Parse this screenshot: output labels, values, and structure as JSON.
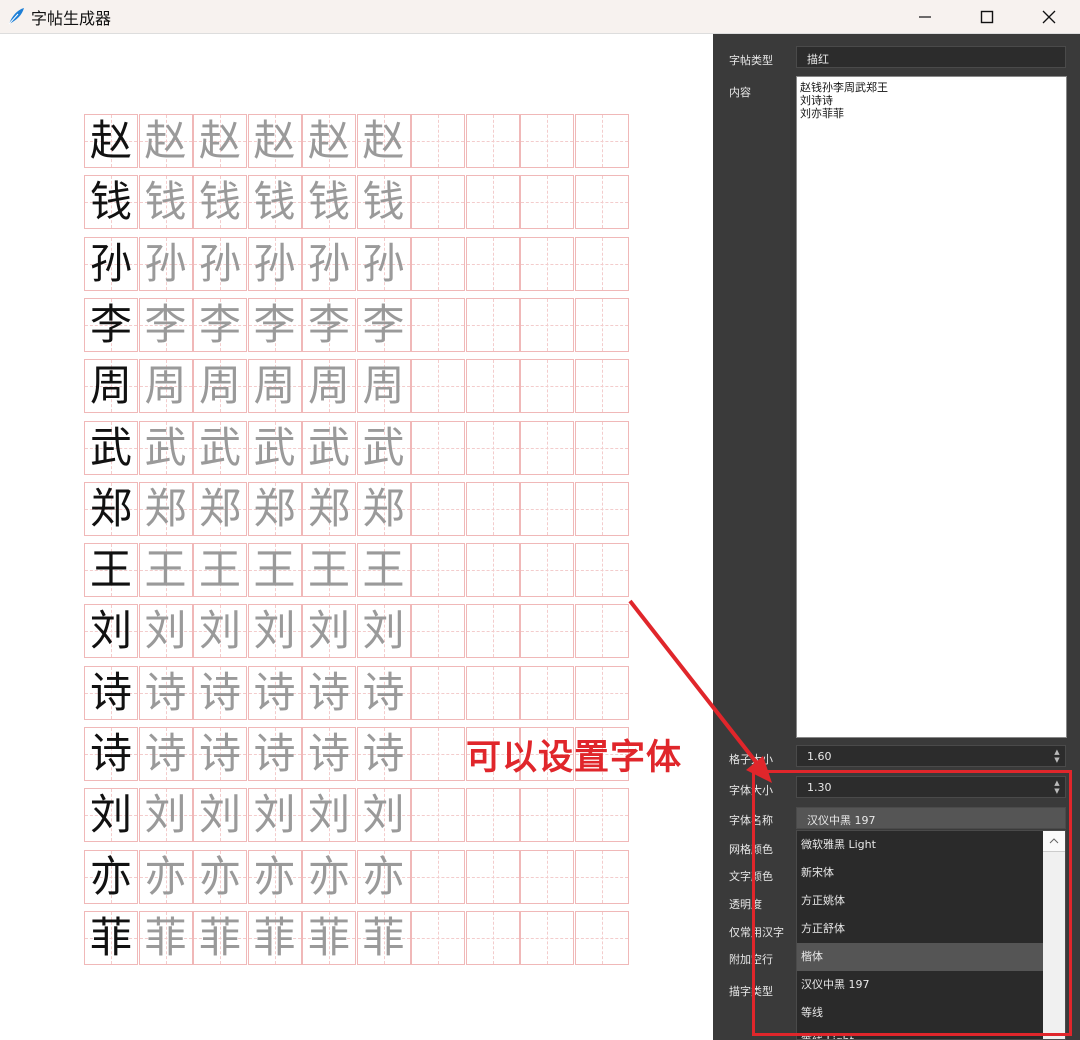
{
  "window": {
    "title": "字帖生成器"
  },
  "sheet": {
    "rows": [
      {
        "char": "赵"
      },
      {
        "char": "钱"
      },
      {
        "char": "孙"
      },
      {
        "char": "李"
      },
      {
        "char": "周"
      },
      {
        "char": "武"
      },
      {
        "char": "郑"
      },
      {
        "char": "王"
      },
      {
        "char": "刘"
      },
      {
        "char": "诗"
      },
      {
        "char": "诗"
      },
      {
        "char": "刘"
      },
      {
        "char": "亦"
      },
      {
        "char": "菲"
      }
    ],
    "copies_per_row": 6,
    "cells_per_row": 10
  },
  "panel": {
    "type_label": "字帖类型",
    "type_value": "描红",
    "content_label": "内容",
    "content_lines": [
      "赵钱孙李周武郑王",
      "刘诗诗",
      "刘亦菲菲"
    ],
    "grid_size_label": "格子大小",
    "grid_size_value": "1.60",
    "font_size_label": "字体大小",
    "font_size_value": "1.30",
    "font_name_label": "字体名称",
    "font_name_value": "汉仪中黑 197",
    "grid_color_label": "网格颜色",
    "text_color_label": "文字颜色",
    "opacity_label": "透明度",
    "common_only_label": "仅常用汉字",
    "extra_blank_label": "附加空行",
    "trace_type_label": "描字类型",
    "font_options": [
      "微软雅黑 Light",
      "新宋体",
      "方正姚体",
      "方正舒体",
      "楷体",
      "汉仪中黑 197",
      "等线",
      "等线 Light"
    ],
    "highlighted_option": "楷体"
  },
  "annotation": {
    "text": "可以设置字体",
    "color": "#e0262b"
  }
}
